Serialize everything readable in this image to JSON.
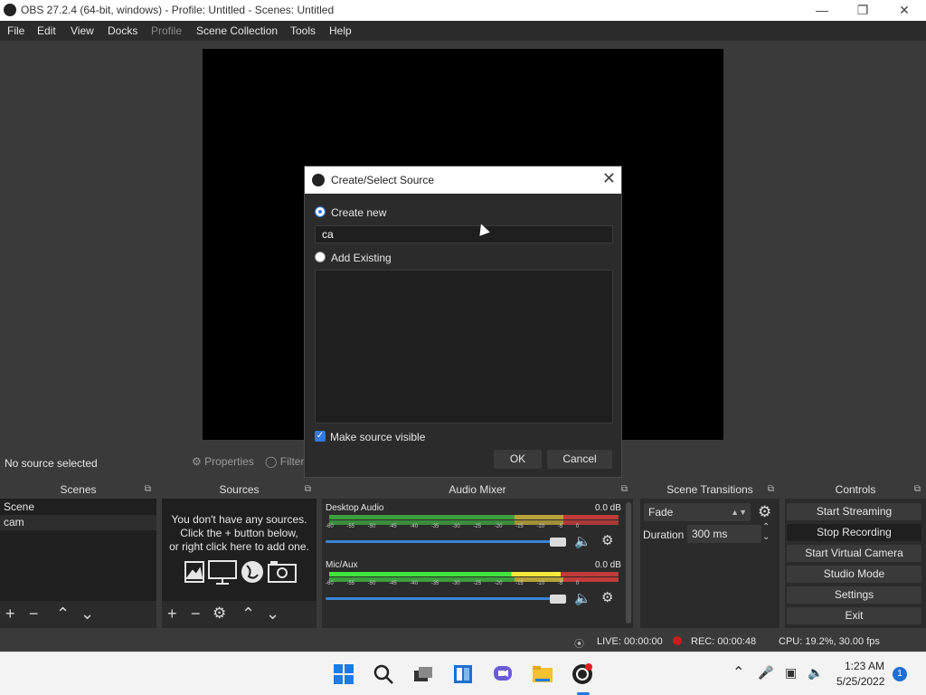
{
  "window": {
    "title": "OBS 27.2.4 (64-bit, windows) - Profile: Untitled - Scenes: Untitled"
  },
  "menu": [
    "File",
    "Edit",
    "View",
    "Docks",
    "Profile",
    "Scene Collection",
    "Tools",
    "Help"
  ],
  "source_toolbar": {
    "no_selection": "No source selected",
    "properties": "Properties",
    "filters": "Filters"
  },
  "docks": {
    "scenes": "Scenes",
    "sources": "Sources",
    "audio_mixer": "Audio Mixer",
    "scene_transitions": "Scene Transitions",
    "controls": "Controls"
  },
  "scenes": [
    "Scene",
    "cam"
  ],
  "sources_hint": "You don't have any sources.\nClick the + button below,\nor right click here to add one.",
  "audio": [
    {
      "name": "Desktop Audio",
      "db": "0.0 dB",
      "meter_level": 1.0,
      "volume": 0.96
    },
    {
      "name": "Mic/Aux",
      "db": "0.0 dB",
      "meter_level": 1.0,
      "volume": 0.96
    }
  ],
  "meter_scale": [
    "-60",
    "-55",
    "-50",
    "-45",
    "-40",
    "-35",
    "-30",
    "-25",
    "-20",
    "-15",
    "-10",
    "-5",
    "0"
  ],
  "transitions": {
    "selected": "Fade",
    "duration_label": "Duration",
    "duration_value": "300 ms"
  },
  "controls": [
    "Start Streaming",
    "Stop Recording",
    "Start Virtual Camera",
    "Studio Mode",
    "Settings",
    "Exit"
  ],
  "status": {
    "live": "LIVE: 00:00:00",
    "rec": "REC: 00:00:48",
    "cpu": "CPU: 19.2%, 30.00 fps"
  },
  "dialog": {
    "title": "Create/Select Source",
    "create_new": "Create new",
    "name_value": "ca",
    "add_existing": "Add Existing",
    "make_visible": "Make source visible",
    "ok": "OK",
    "cancel": "Cancel"
  },
  "taskbar": {
    "time": "1:23 AM",
    "date": "5/25/2022",
    "notifications": "1"
  }
}
